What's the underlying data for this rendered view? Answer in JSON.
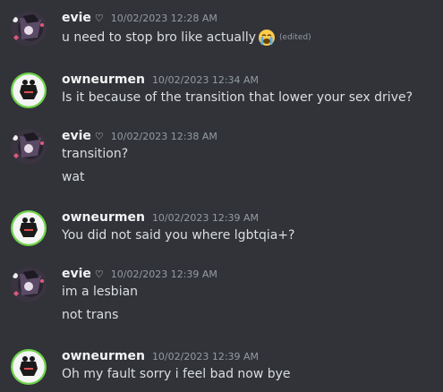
{
  "messages": [
    {
      "author": "evie",
      "heart": "♡",
      "time": "10/02/2023 12:28 AM",
      "lines": [
        "u need to stop bro like actually"
      ],
      "emoji": "loudly-crying-face",
      "edited": "(edited)"
    },
    {
      "author": "owneurmen",
      "time": "10/02/2023 12:34 AM",
      "lines": [
        "Is it because of the transition that lower your sex drive?"
      ]
    },
    {
      "author": "evie",
      "heart": "♡",
      "time": "10/02/2023 12:38 AM",
      "lines": [
        "transition?",
        "wat"
      ]
    },
    {
      "author": "owneurmen",
      "time": "10/02/2023 12:39 AM",
      "lines": [
        "You did not said you where lgbtqia+?"
      ]
    },
    {
      "author": "evie",
      "heart": "♡",
      "time": "10/02/2023 12:39 AM",
      "lines": [
        "im a lesbian",
        "not trans"
      ]
    },
    {
      "author": "owneurmen",
      "time": "10/02/2023 12:39 AM",
      "lines": [
        "Oh my fault sorry i feel bad now bye"
      ]
    }
  ],
  "colors": {
    "background": "#313338",
    "author": "#f2f3f5",
    "timestamp": "#949ba4",
    "text": "#dbdee1",
    "green_ring": "#6fd34a"
  }
}
